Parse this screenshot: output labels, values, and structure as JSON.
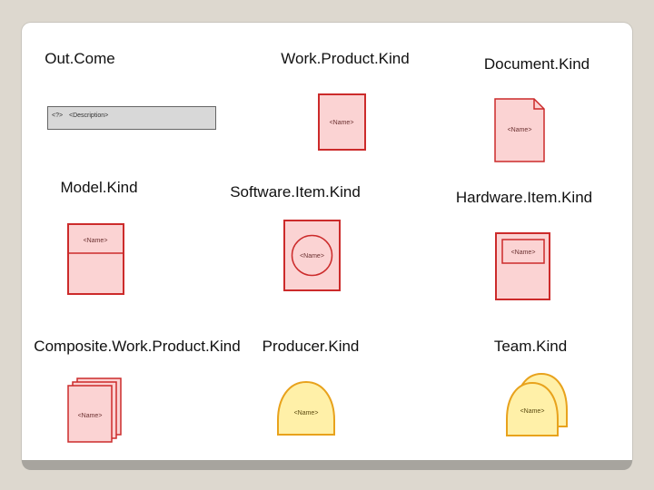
{
  "labels": {
    "outcome": "Out.Come",
    "work_product_kind": "Work.Product.Kind",
    "document_kind": "Document.Kind",
    "model_kind": "Model.Kind",
    "software_item_kind": "Software.Item.Kind",
    "hardware_item_kind": "Hardware.Item.Kind",
    "composite_work_product_kind": "Composite.Work.Product.Kind",
    "producer_kind": "Producer.Kind",
    "team_kind": "Team.Kind"
  },
  "symbols": {
    "outcome_id": "<?>",
    "outcome_text": "<Description>",
    "name_placeholder": "<Name>"
  },
  "colors": {
    "work_product_fill": "#fbd3d3",
    "work_product_stroke": "#cc2b2b",
    "producer_fill": "#fff0a8",
    "producer_stroke": "#e8a21c",
    "outcome_fill": "#d8d8d8",
    "outcome_stroke": "#666666"
  }
}
